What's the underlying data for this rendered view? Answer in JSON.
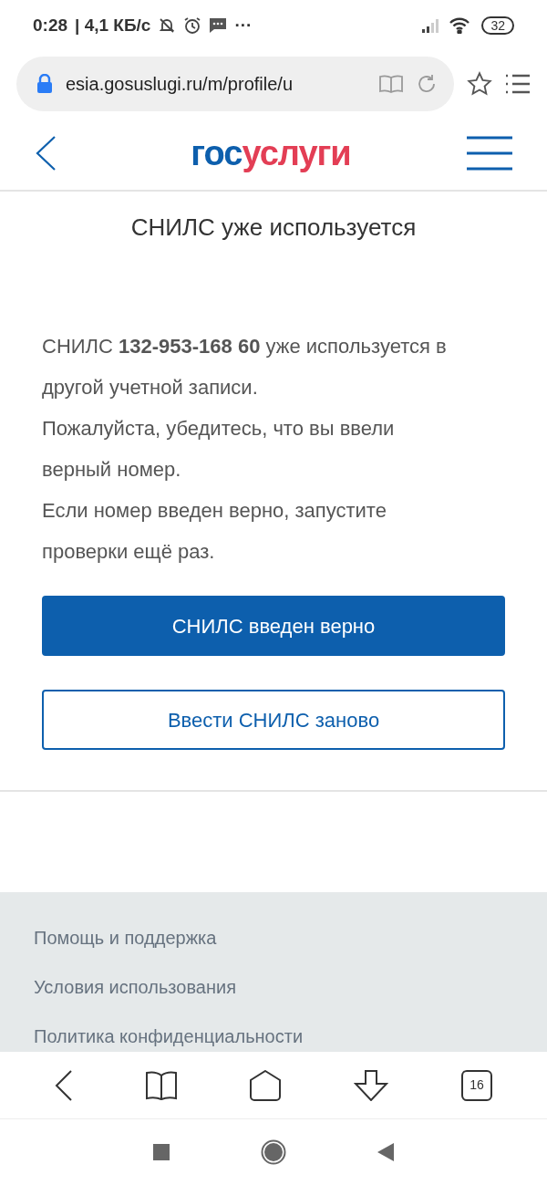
{
  "status_bar": {
    "time": "0:28",
    "speed": "| 4,1 КБ/с",
    "more": "···",
    "battery": "32"
  },
  "address_bar": {
    "url": "esia.gosuslugi.ru/m/profile/u"
  },
  "header": {
    "logo": {
      "first": "гос",
      "second": "услуги"
    }
  },
  "page": {
    "title": "СНИЛС уже используется",
    "paragraphs": [
      "СНИЛС **132-953-168 60** уже используется в другой учетной записи.",
      "Пожалуйста, убедитесь, что вы ввели верный номер.",
      "Если номер введен верно, запустите проверки ещё раз."
    ],
    "buttons": [
      {
        "label": "СНИЛС введен верно",
        "kind": "primary"
      },
      {
        "label": "Ввести СНИЛС заново",
        "kind": "outline"
      }
    ]
  },
  "footer": {
    "links": [
      "Помощь и поддержка",
      "Условия использования",
      "Политика конфиденциальности"
    ]
  },
  "browser_toolbar": {
    "tabs_count": "16"
  }
}
